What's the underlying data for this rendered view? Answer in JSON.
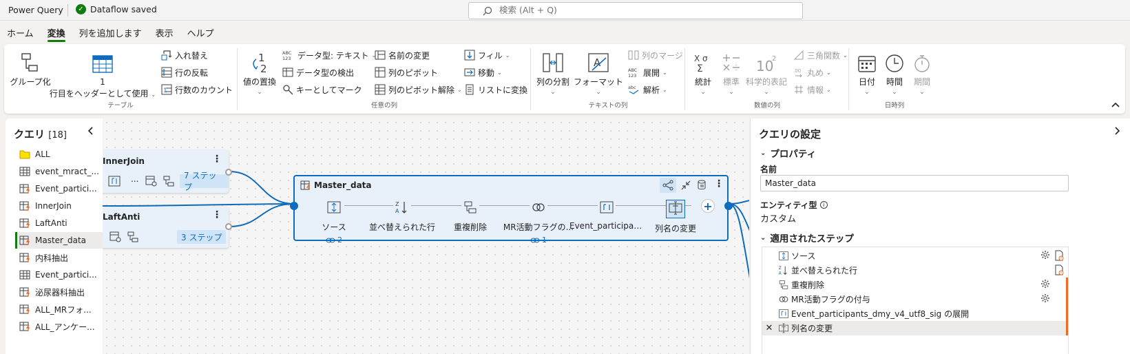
{
  "titlebar": {
    "app_name": "Power Query",
    "status": "Dataflow saved",
    "search_placeholder": "検索 (Alt + Q)"
  },
  "menu_tabs": [
    "ホーム",
    "変換",
    "列を追加します",
    "表示",
    "ヘルプ"
  ],
  "active_tab": "変換",
  "ribbon": {
    "table_group": {
      "label": "テーブル",
      "group_by": "グループ化",
      "use_first_row_1": "1",
      "use_first_row_2": "行目をヘッダーとして使用",
      "transpose": "入れ替え",
      "reverse_rows": "行の反転",
      "count_rows": "行数のカウント"
    },
    "any_column_group": {
      "label": "任意の列",
      "replace_values": "値の置換",
      "data_type": "データ型: テキスト",
      "detect_type": "データ型の検出",
      "mark_as_key": "キーとしてマーク",
      "rename": "名前の変更",
      "pivot": "列のピボット",
      "unpivot": "列のピボット解除",
      "fill": "フィル",
      "move": "移動",
      "convert_to_list": "リストに変換"
    },
    "text_column_group": {
      "label": "テキストの列",
      "split_column": "列の分割",
      "format": "フォーマット",
      "merge_columns": "列のマージ",
      "expand": "展開",
      "parse": "解析"
    },
    "number_column_group": {
      "label": "数値の列",
      "statistics": "統計",
      "standard": "標準",
      "scientific": "科学的表記",
      "trigonometry": "三角関数",
      "rounding": "丸め",
      "information": "情報"
    },
    "datetime_group": {
      "label": "日時列",
      "date": "日付",
      "time": "時間",
      "duration": "期間"
    }
  },
  "queries": {
    "title": "クエリ",
    "count": "[18]",
    "items": [
      {
        "name": "ALL",
        "icon": "folder-icon"
      },
      {
        "name": "event_mract_...",
        "icon": "table-icon"
      },
      {
        "name": "Event_partici...",
        "icon": "table-lightning-icon"
      },
      {
        "name": "InnerJoin",
        "icon": "table-lightning-icon"
      },
      {
        "name": "LaftAnti",
        "icon": "table-lightning-icon"
      },
      {
        "name": "Master_data",
        "icon": "table-lightning-icon"
      },
      {
        "name": "内科抽出",
        "icon": "table-lightning-icon"
      },
      {
        "name": "Event_partici...",
        "icon": "table-icon"
      },
      {
        "name": "泌尿器科抽出",
        "icon": "table-lightning-icon"
      },
      {
        "name": "ALL_MRフォ...",
        "icon": "table-lightning-icon"
      },
      {
        "name": "ALL_アンケー...",
        "icon": "table-lightning-icon"
      }
    ],
    "selected": "Master_data"
  },
  "diagram": {
    "innerjoin": {
      "title": "InnerJoin",
      "steps": "7 ステップ",
      "ellipsis": "..."
    },
    "laftanti": {
      "title": "LaftAnti",
      "steps": "3 ステップ"
    },
    "master": {
      "title": "Master_data",
      "steps": [
        {
          "label": "ソース",
          "refs": "2"
        },
        {
          "label": "並べ替えられた行",
          "refs": ""
        },
        {
          "label": "重複削除",
          "refs": ""
        },
        {
          "label": "MR活動フラグの...",
          "refs": "1"
        },
        {
          "label": "Event_participant...",
          "refs": ""
        },
        {
          "label": "列名の変更",
          "refs": ""
        }
      ]
    }
  },
  "settings": {
    "title": "クエリの設定",
    "properties_label": "プロパティ",
    "name_label": "名前",
    "name_value": "Master_data",
    "entity_type_label": "エンティティ型",
    "entity_type_value": "カスタム",
    "applied_steps_label": "適用されたステップ",
    "applied_steps": [
      {
        "label": "ソース",
        "gear": true
      },
      {
        "label": "並べ替えられた行",
        "gear": false
      },
      {
        "label": "重複削除",
        "gear": true
      },
      {
        "label": "MR活動フラグの付与",
        "gear": true
      },
      {
        "label": "Event_participants_dmy_v4_utf8_sig の展開",
        "gear": false
      },
      {
        "label": "列名の変更",
        "gear": false
      }
    ]
  },
  "colors": {
    "accent_green": "#107c10",
    "accent_blue": "#0f6cbd",
    "warning_orange": "#e86e28",
    "node_bg": "#e8f1fa"
  }
}
